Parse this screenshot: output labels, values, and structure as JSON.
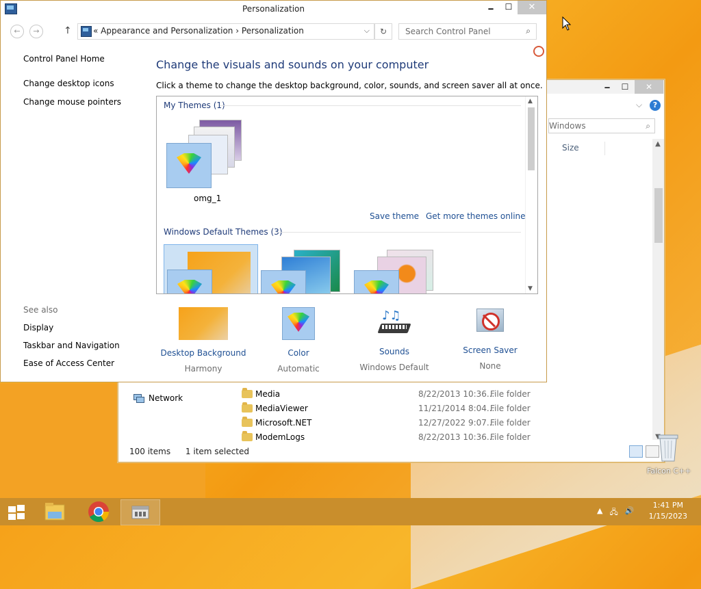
{
  "personalization": {
    "title": "Personalization",
    "min": "🗕",
    "max": "☐",
    "close": "✕",
    "nav": {
      "back": "←",
      "forward": "→",
      "up": "↑",
      "breadcrumb_prefix": "«",
      "breadcrumb_1": "Appearance and Personalization",
      "breadcrumb_sep": "›",
      "breadcrumb_2": "Personalization",
      "dropdown": "⌵",
      "refresh": "↻",
      "search_placeholder": "Search Control Panel",
      "search_icon": "⌕"
    },
    "left_nav": {
      "home": "Control Panel Home",
      "links": [
        "Change desktop icons",
        "Change mouse pointers"
      ]
    },
    "see_also": {
      "header": "See also",
      "links": [
        "Display",
        "Taskbar and Navigation",
        "Ease of Access Center"
      ]
    },
    "heading": "Change the visuals and sounds on your computer",
    "subtext": "Click a theme to change the desktop background, color, sounds, and screen saver all at once.",
    "my_themes_header": "My Themes (1)",
    "my_theme_name": "omg_1",
    "save_theme": "Save theme",
    "more_themes": "Get more themes online",
    "default_themes_header": "Windows Default Themes (3)",
    "bottom": [
      {
        "title": "Desktop Background",
        "sub": "Harmony",
        "icon": "desktop-background-icon"
      },
      {
        "title": "Color",
        "sub": "Automatic",
        "icon": "color-icon"
      },
      {
        "title": "Sounds",
        "sub": "Windows Default",
        "icon": "sounds-icon"
      },
      {
        "title": "Screen Saver",
        "sub": "None",
        "icon": "screen-saver-icon"
      }
    ]
  },
  "explorer": {
    "min": "🗕",
    "max": "☐",
    "close": "✕",
    "search_placeholder": "Windows",
    "search_icon": "⌕",
    "help": "?",
    "chevron": "⌵",
    "column_size": "Size",
    "nav_network": "Network",
    "files": [
      {
        "name": "Media",
        "date": "8/22/2013 10:36...",
        "type": "File folder"
      },
      {
        "name": "MediaViewer",
        "date": "11/21/2014 8:04...",
        "type": "File folder"
      },
      {
        "name": "Microsoft.NET",
        "date": "12/27/2022 9:07...",
        "type": "File folder"
      },
      {
        "name": "ModemLogs",
        "date": "8/22/2013 10:36...",
        "type": "File folder"
      }
    ],
    "status_items": "100 items",
    "status_selected": "1 item selected"
  },
  "desktop": {
    "recycle_label": "Falcon C++"
  },
  "taskbar": {
    "time": "1:41 PM",
    "date": "1/15/2023",
    "tray_up": "▲",
    "tray_network": "🖧",
    "tray_volume": "🔊"
  },
  "colors": {
    "heading_blue": "#1e3a78",
    "link_blue": "#1e4f93",
    "taskbar": "#c98e2c"
  }
}
